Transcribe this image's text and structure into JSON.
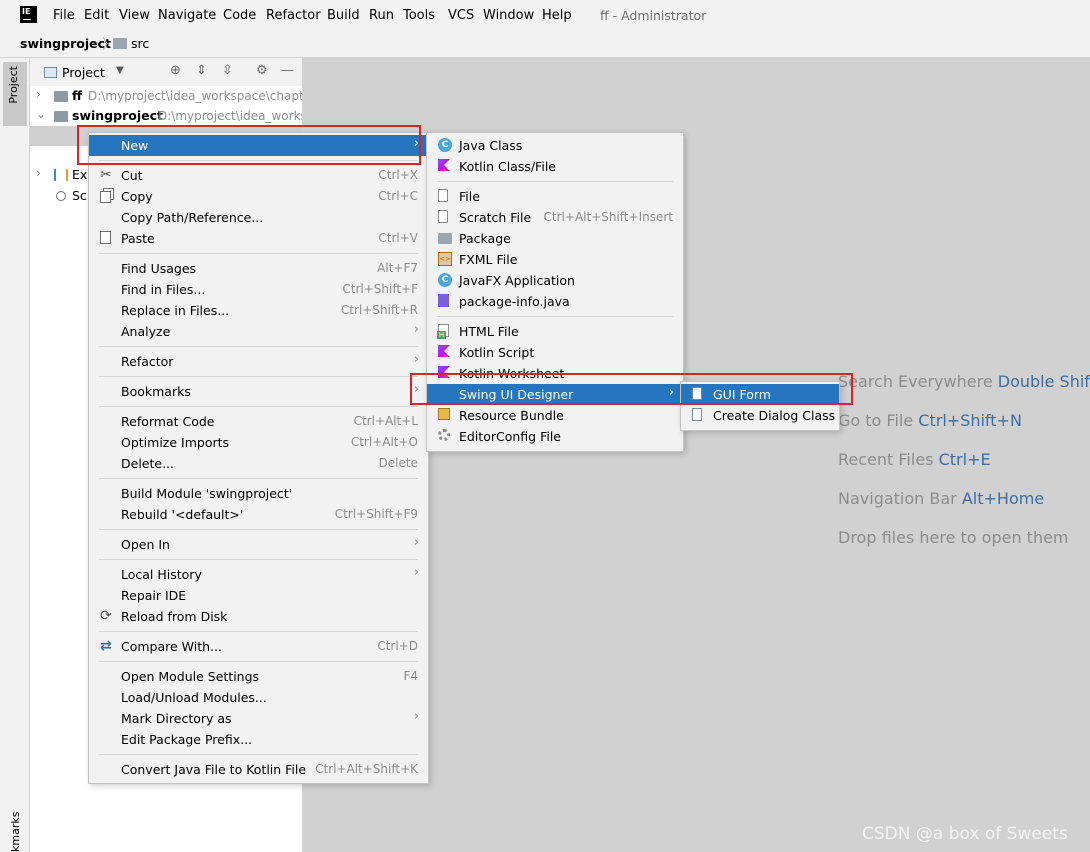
{
  "window": {
    "logo_text": "IE",
    "title": "ff - Administrator",
    "menu": [
      "File",
      "Edit",
      "View",
      "Navigate",
      "Code",
      "Refactor",
      "Build",
      "Run",
      "Tools",
      "VCS",
      "Window",
      "Help"
    ]
  },
  "navbar": {
    "project": "swingproject",
    "folder": "src"
  },
  "left_stripe": {
    "project_tab": "Project",
    "bookmarks_tab": "kmarks"
  },
  "project_panel": {
    "title": "Project",
    "tree": [
      {
        "name": "ff",
        "path": "D:\\myproject\\idea_workspace\\chapte",
        "expanded": false
      },
      {
        "name": "swingproject",
        "path": "D:\\myproject\\idea_works",
        "expanded": true
      },
      {
        "name": "Ex"
      },
      {
        "name": "Sc"
      }
    ]
  },
  "context_menu": {
    "items": [
      {
        "label": "New",
        "submenu": true,
        "highlighted": true
      },
      {
        "label": "Cut",
        "shortcut": "Ctrl+X",
        "icon": "scissors-icon"
      },
      {
        "label": "Copy",
        "shortcut": "Ctrl+C",
        "icon": "copy-icon"
      },
      {
        "label": "Copy Path/Reference..."
      },
      {
        "label": "Paste",
        "shortcut": "Ctrl+V",
        "icon": "paste-icon"
      },
      {
        "label": "Find Usages",
        "shortcut": "Alt+F7"
      },
      {
        "label": "Find in Files...",
        "shortcut": "Ctrl+Shift+F"
      },
      {
        "label": "Replace in Files...",
        "shortcut": "Ctrl+Shift+R"
      },
      {
        "label": "Analyze",
        "submenu": true
      },
      {
        "label": "Refactor",
        "submenu": true
      },
      {
        "label": "Bookmarks",
        "submenu": true
      },
      {
        "label": "Reformat Code",
        "shortcut": "Ctrl+Alt+L"
      },
      {
        "label": "Optimize Imports",
        "shortcut": "Ctrl+Alt+O"
      },
      {
        "label": "Delete...",
        "shortcut": "Delete"
      },
      {
        "label": "Build Module 'swingproject'"
      },
      {
        "label": "Rebuild '<default>'",
        "shortcut": "Ctrl+Shift+F9"
      },
      {
        "label": "Open In",
        "submenu": true
      },
      {
        "label": "Local History",
        "submenu": true
      },
      {
        "label": "Repair IDE"
      },
      {
        "label": "Reload from Disk",
        "icon": "reload-icon"
      },
      {
        "label": "Compare With...",
        "shortcut": "Ctrl+D",
        "icon": "compare-icon"
      },
      {
        "label": "Open Module Settings",
        "shortcut": "F4"
      },
      {
        "label": "Load/Unload Modules..."
      },
      {
        "label": "Mark Directory as",
        "submenu": true
      },
      {
        "label": "Edit Package Prefix..."
      },
      {
        "label": "Convert Java File to Kotlin File",
        "shortcut": "Ctrl+Alt+Shift+K"
      }
    ]
  },
  "new_menu": {
    "items": [
      {
        "label": "Java Class",
        "icon": "java-class-icon"
      },
      {
        "label": "Kotlin Class/File",
        "icon": "kotlin-icon"
      },
      {
        "label": "File",
        "icon": "file-icon"
      },
      {
        "label": "Scratch File",
        "shortcut": "Ctrl+Alt+Shift+Insert",
        "icon": "scratch-file-icon"
      },
      {
        "label": "Package",
        "icon": "package-icon"
      },
      {
        "label": "FXML File",
        "icon": "fxml-icon"
      },
      {
        "label": "JavaFX Application",
        "icon": "javafx-icon"
      },
      {
        "label": "package-info.java",
        "icon": "package-info-icon"
      },
      {
        "label": "HTML File",
        "icon": "html-icon"
      },
      {
        "label": "Kotlin Script",
        "icon": "kotlin-script-icon"
      },
      {
        "label": "Kotlin Worksheet",
        "icon": "kotlin-worksheet-icon"
      },
      {
        "label": "Swing UI Designer",
        "submenu": true,
        "highlighted": true
      },
      {
        "label": "Resource Bundle",
        "icon": "resource-bundle-icon"
      },
      {
        "label": "EditorConfig File",
        "icon": "editorconfig-icon"
      }
    ]
  },
  "swing_menu": {
    "items": [
      {
        "label": "GUI Form",
        "highlighted": true,
        "icon": "gui-form-icon"
      },
      {
        "label": "Create Dialog Class",
        "icon": "dialog-class-icon"
      }
    ]
  },
  "editor_hints": [
    {
      "text": "Search Everywhere",
      "shortcut": "Double Shift"
    },
    {
      "text": "Go to File",
      "shortcut": "Ctrl+Shift+N"
    },
    {
      "text": "Recent Files",
      "shortcut": "Ctrl+E"
    },
    {
      "text": "Navigation Bar",
      "shortcut": "Alt+Home"
    },
    {
      "text": "Drop files here to open them",
      "shortcut": ""
    }
  ],
  "watermark": "CSDN @a box of Sweets",
  "colors": {
    "highlight": "#2675bf",
    "annotation": "#e0212b",
    "editor_bg": "#d1d1d1",
    "shortcut_blue": "#3a6ea5"
  }
}
